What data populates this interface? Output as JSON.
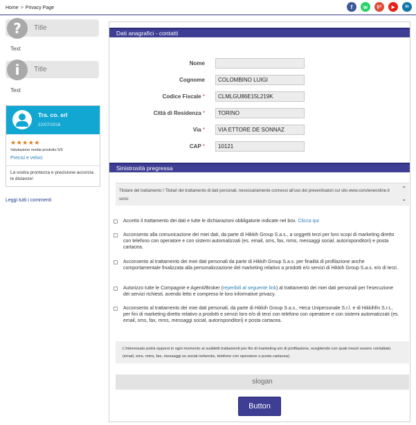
{
  "breadcrumb": {
    "home": "Home",
    "separator": ">",
    "current": "Privacy Page"
  },
  "social": [
    {
      "name": "facebook",
      "glyph": "f",
      "color": "#3b5998"
    },
    {
      "name": "whatsapp",
      "glyph": "w",
      "color": "#25d366"
    },
    {
      "name": "google-plus",
      "glyph": "g+",
      "color": "#dd4b39"
    },
    {
      "name": "youtube",
      "glyph": "▶",
      "color": "#e62117"
    },
    {
      "name": "linkedin",
      "glyph": "in",
      "color": "#0e76a8"
    }
  ],
  "sidebar": {
    "box1": {
      "icon": "?",
      "title": "Title",
      "text": "Text"
    },
    "box2": {
      "icon": "i",
      "title": "Title",
      "text": "Text"
    },
    "review": {
      "company": "Tra. co. srl",
      "date": "22/07/2016",
      "stars": "★★★★★",
      "rating_text": "Valutazione media prodotto 5/5",
      "subtitle": "Precisi e veloci",
      "quote": "La vostra prontezza e precisione accorcia le distanze!"
    },
    "read_all": "Leggi tutti i commenti"
  },
  "sections": {
    "anagrafici": "Dati anagrafici - contatti",
    "sinistrosita": "Sinistrosità pregressa"
  },
  "fields": [
    {
      "label": "Nome",
      "required": "",
      "value": ""
    },
    {
      "label": "Cognome",
      "required": "",
      "value": "COLOMBINO LUIGI"
    },
    {
      "label": "Codice Fiscale",
      "required": "*",
      "value": "CLMLGU86E15L219K"
    },
    {
      "label": "Città di Residenza",
      "required": "*",
      "value": "TORINO"
    },
    {
      "label": "Via",
      "required": "*",
      "value": "VIA ETTORE DE SONNAZ"
    },
    {
      "label": "CAP",
      "required": "*",
      "value": "10121"
    }
  ],
  "privacy_text": "Titolare del trattamento I Titolari del trattamento di dati personali, necessariamente connessi all'uso dei preventivatori sul sito www.convieneonline.it sono:",
  "consents": [
    {
      "text": "Accetto il trattamento dei dati e tutte le dichiarazioni obbligatorie indicate nel box.",
      "link": "Clicca qui",
      "after": ""
    },
    {
      "text": "Acconsento alla comunicazione dei miei dati, da parte di Hikkih Group S.a.s., a soggetti terzi per loro scopi di marketing diretto con telefono con operatore e con sistemi automatizzati (es. email, sms, fax, mms, messaggi social, autorisponditori) e posta cartacea.",
      "link": "",
      "after": ""
    },
    {
      "text": "Acconsento al trattamento dei miei dati personali da parte di Hikkih Group S.a.s. per finalità di profilazione anche comportamentale finalizzata alla personalizzazione del marketing relativo a prodotti e/o servizi di Hikkih Group S.a.s. e/o di terzi.",
      "link": "",
      "after": ""
    },
    {
      "text": "Autorizzo tutte le Compagnie e Agenti/Broker (",
      "link": "reperibili al seguente link",
      "after": ") al trattamento dei miei dati personali per l'esecuzione dei servizi richiesti, avendo letto e compreso le loro informative privacy."
    },
    {
      "text": "Acconsento al trattamento dei miei dati personali, da parte di Hikkih Group S.a.s., Heca Unipersonale S.r.l. e di Hikkihfin S.r.L, per fini di marketing diretto relativo a prodotti e servizi loro e/o di terzi con telefono con operatore e con sistemi automatizzati (es. email, sms, fax, mms, messaggi social, autorisponditori) e posta cartacea.",
      "link": "",
      "after": ""
    }
  ],
  "notice": "L'interessato potrà opporsi in ogni momento ai suddetti trattamenti per fini di marketing e/o di profilazione, scegliendo con quali mezzi essere contattato (email, sms, mms, fax, messaggi su social networks, telefono con operatore o posta cartacea).",
  "slogan": "slogan",
  "button": "Button"
}
